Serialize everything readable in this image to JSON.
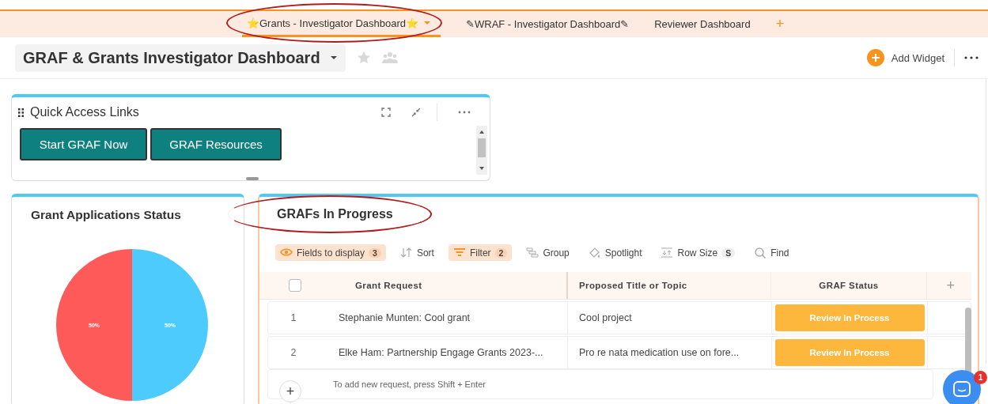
{
  "tabs": [
    {
      "label": "⭐Grants - Investigator Dashboard⭐",
      "selected": true,
      "circled": true
    },
    {
      "label": "✎WRAF - Investigator Dashboard✎",
      "selected": false,
      "circled": false
    },
    {
      "label": "Reviewer Dashboard",
      "selected": false,
      "circled": false
    }
  ],
  "tab_add": "+",
  "header": {
    "title": "GRAF & Grants Investigator Dashboard",
    "favorite": false,
    "add_widget": "Add Widget"
  },
  "quick_links": {
    "title": "Quick Access Links",
    "buttons": [
      "Start GRAF Now",
      "GRAF Resources"
    ]
  },
  "status_widget": {
    "title": "Grant Applications Status",
    "chart_data": {
      "type": "pie",
      "values": [
        50,
        50
      ],
      "colors": [
        "#fe5a5a",
        "#4ecbfd"
      ],
      "data_labels": "value_labels",
      "value_labels": [
        "50%",
        "50%"
      ]
    }
  },
  "progress_widget": {
    "title": "GRAFs In Progress",
    "circled": true,
    "toolbar": [
      {
        "label": "Fields to display",
        "badge": "3",
        "active": true
      },
      {
        "label": "Sort",
        "active": false
      },
      {
        "label": "Filter",
        "badge": "2",
        "active": true
      },
      {
        "label": "Group",
        "active": false
      },
      {
        "label": "Spotlight",
        "active": false
      },
      {
        "label": "Row Size",
        "badge": "S",
        "active": false
      },
      {
        "label": "Find",
        "active": false
      }
    ],
    "table": {
      "all_checked": false,
      "columns": [
        "Grant Request",
        "Proposed Title or Topic",
        "GRAF Status"
      ],
      "rows": [
        {
          "number": "1",
          "cells": [
            "Stephanie Munten: Cool grant",
            "Cool project",
            "Review In Process"
          ]
        },
        {
          "number": "2",
          "cells": [
            "Elke Ham: Partnership Engage Grants 2023-...",
            "Pro re nata medication use on fore...",
            "Review In Process"
          ]
        }
      ],
      "add_hint": "To add new request, press Shift + Enter"
    }
  },
  "chat": {
    "unread": "1"
  }
}
